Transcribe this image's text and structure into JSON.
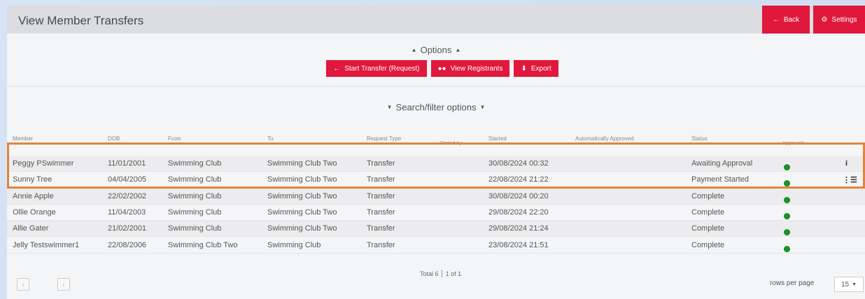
{
  "header": {
    "title": "View Member Transfers",
    "back_label": "Back",
    "settings_label": "Settings"
  },
  "options": {
    "title": "Options",
    "start_transfer_label": "Start Transfer (Request)",
    "view_registrants_label": "View Registrants",
    "export_label": "Export"
  },
  "search": {
    "title": "Search/filter options"
  },
  "table": {
    "columns": [
      "Member",
      "DOB",
      "From",
      "To",
      "Request Type",
      "Started by",
      "Started",
      "Automatically Approved",
      "Status",
      "Approvals"
    ],
    "rows": [
      {
        "member": "Peggy PSwimmer",
        "dob": "11/01/2001",
        "from": "Swimming Club",
        "to": "Swimming Club Two",
        "type": "Transfer",
        "started": "30/08/2024 00:32",
        "status": "Awaiting Approval"
      },
      {
        "member": "Sunny Tree",
        "dob": "04/04/2005",
        "from": "Swimming Club",
        "to": "Swimming Club Two",
        "type": "Transfer",
        "started": "22/08/2024 21:22",
        "status": "Payment Started"
      },
      {
        "member": "Annie Apple",
        "dob": "22/02/2002",
        "from": "Swimming Club",
        "to": "Swimming Club Two",
        "type": "Transfer",
        "started": "30/08/2024 00:20",
        "status": "Complete"
      },
      {
        "member": "Ollie Orange",
        "dob": "11/04/2003",
        "from": "Swimming Club",
        "to": "Swimming Club Two",
        "type": "Transfer",
        "started": "29/08/2024 22:20",
        "status": "Complete"
      },
      {
        "member": "Allie Gater",
        "dob": "21/02/2001",
        "from": "Swimming Club",
        "to": "Swimming Club Two",
        "type": "Transfer",
        "started": "29/08/2024 21:24",
        "status": "Complete"
      },
      {
        "member": "Jelly Testswimmer1",
        "dob": "22/08/2006",
        "from": "Swimming Club Two",
        "to": "Swimming Club",
        "type": "Transfer",
        "started": "23/08/2024 21:51",
        "status": "Complete"
      }
    ]
  },
  "footer": {
    "total": "Total 6",
    "pages": "1 of 1",
    "rows_per_page_label": "rows per page",
    "rows_per_page_value": "15"
  },
  "colors": {
    "accent": "#e0183c",
    "approval_pending": "#f5a623",
    "approval_done": "#1f8f2e",
    "highlight": "#e2843a"
  },
  "icons": [
    "arrow-left-icon",
    "cogs-icon",
    "caret-up-icon",
    "caret-down-icon",
    "users-icon",
    "download-icon",
    "info-icon",
    "list-icon",
    "chevron-left-icon",
    "chevron-right-icon"
  ]
}
